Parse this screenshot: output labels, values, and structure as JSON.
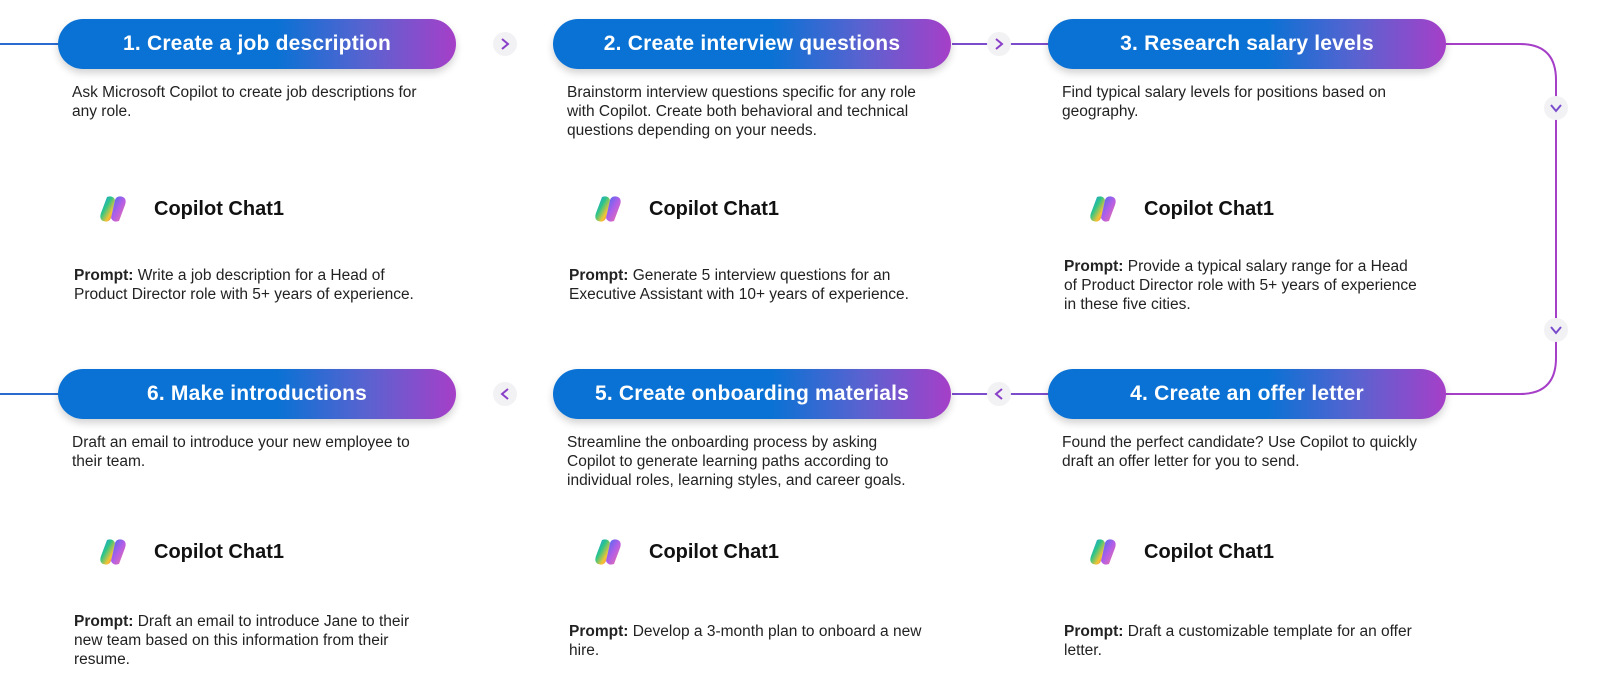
{
  "colors": {
    "blue": "#0a72d4",
    "purple": "#a63fc8",
    "line_blue": "#2a5ecb",
    "line_purple": "#a63fc8"
  },
  "steps": [
    {
      "title": "1. Create a job description",
      "description": "Ask Microsoft Copilot to create job descriptions for any role.",
      "app": "Copilot Chat1",
      "prompt_label": "Prompt:",
      "prompt": "Write a job description for a Head of Product Director role with 5+ years of experience."
    },
    {
      "title": "2. Create interview questions",
      "description": "Brainstorm interview questions specific for any role with Copilot. Create both behavioral and technical questions depending on your needs.",
      "app": "Copilot Chat1",
      "prompt_label": "Prompt:",
      "prompt": "Generate 5 interview questions for an Executive Assistant with 10+ years of experience."
    },
    {
      "title": "3. Research salary levels",
      "description": "Find typical salary levels for positions based on geography.",
      "app": "Copilot Chat1",
      "prompt_label": "Prompt:",
      "prompt": "Provide a typical salary range for a Head of Product Director role with 5+ years of experience in these five cities."
    },
    {
      "title": "4. Create an offer letter",
      "description": "Found the perfect candidate? Use Copilot to quickly draft an offer letter for you to send.",
      "app": "Copilot Chat1",
      "prompt_label": "Prompt:",
      "prompt": "Draft a customizable template for an offer letter."
    },
    {
      "title": "5. Create onboarding materials",
      "description": "Streamline the onboarding process by asking Copilot to generate learning paths according to individual roles, learning styles, and career goals.",
      "app": "Copilot Chat1",
      "prompt_label": "Prompt:",
      "prompt": "Develop a 3-month plan to onboard a new hire."
    },
    {
      "title": "6. Make introductions",
      "description": "Draft an email to introduce your new employee to their team.",
      "app": "Copilot Chat1",
      "prompt_label": "Prompt:",
      "prompt": "Draft an email to introduce Jane to their new team based on this information from their resume."
    }
  ],
  "icons": {
    "arrow_right": "chevron-right-icon",
    "arrow_left": "chevron-left-icon",
    "arrow_down": "chevron-down-icon",
    "app_logo": "copilot-logo-icon"
  }
}
